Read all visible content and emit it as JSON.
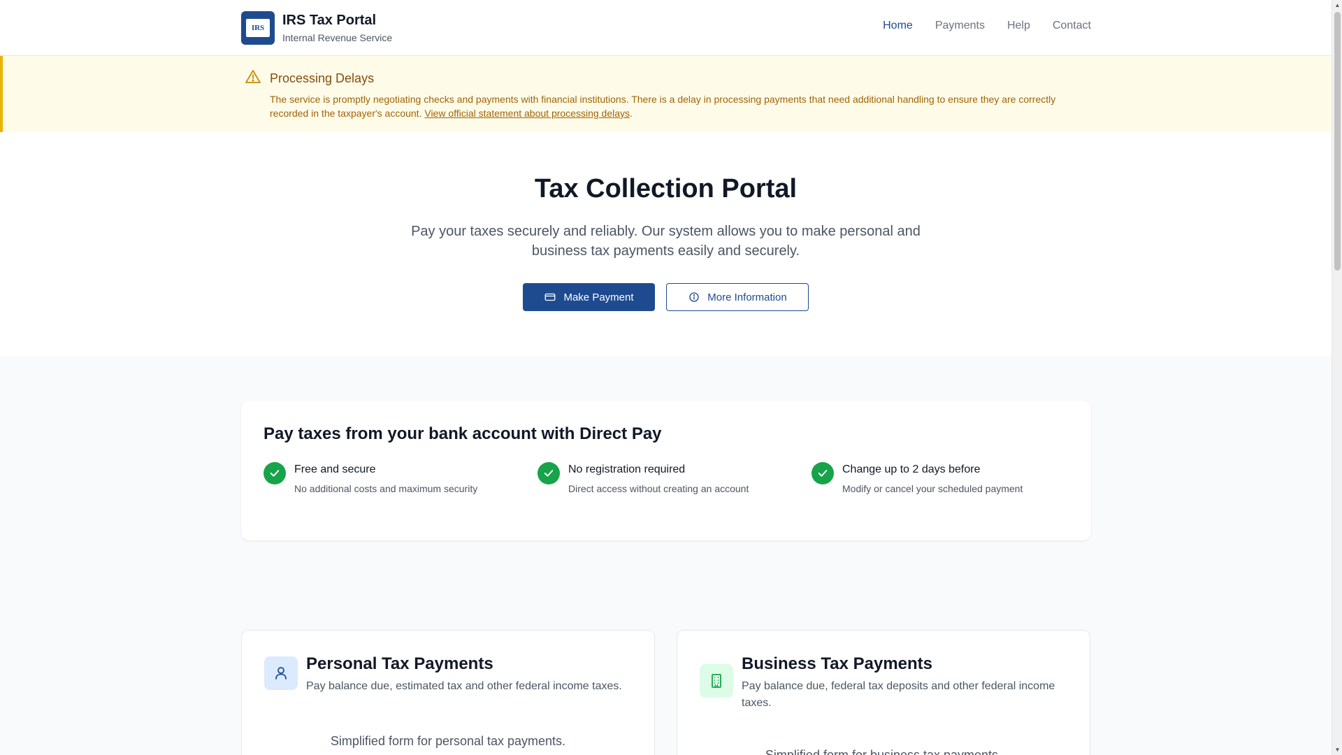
{
  "header": {
    "logo_text": "IRS",
    "title": "IRS Tax Portal",
    "subtitle": "Internal Revenue Service",
    "nav": [
      {
        "label": "Home",
        "active": true
      },
      {
        "label": "Payments",
        "active": false
      },
      {
        "label": "Help",
        "active": false
      },
      {
        "label": "Contact",
        "active": false
      }
    ]
  },
  "alert": {
    "icon": "warning-icon",
    "title": "Processing Delays",
    "body": "The service is promptly negotiating checks and payments with financial institutions. There is a delay in processing payments that need additional handling to ensure they are correctly recorded in the taxpayer's account.",
    "link_text": "View official statement about processing delays",
    "link_suffix": "."
  },
  "hero": {
    "title": "Tax Collection Portal",
    "subtitle": "Pay your taxes securely and reliably. Our system allows you to make personal and business tax payments easily and securely.",
    "primary_button": {
      "label": "Make Payment",
      "icon": "credit-card-icon"
    },
    "secondary_button": {
      "label": "More Information",
      "icon": "info-icon"
    }
  },
  "direct_pay": {
    "title": "Pay taxes from your bank account with Direct Pay",
    "features": [
      {
        "title": "Free and secure",
        "description": "No additional costs and maximum security"
      },
      {
        "title": "No registration required",
        "description": "Direct access without creating an account"
      },
      {
        "title": "Change up to 2 days before",
        "description": "Modify or cancel your scheduled payment"
      }
    ]
  },
  "payment_options": {
    "personal": {
      "icon": "user-icon",
      "title": "Personal Tax Payments",
      "description": "Pay balance due, estimated tax and other federal income taxes.",
      "note": "Simplified form for personal tax payments."
    },
    "business": {
      "icon": "building-icon",
      "title": "Business Tax Payments",
      "description": "Pay balance due, federal tax deposits and other federal income taxes.",
      "note": "Simplified form for business tax payments."
    }
  },
  "colors": {
    "brand": "#1e4b8f",
    "alert_bg": "#fefce8",
    "alert_border": "#eab308",
    "alert_text": "#a16207",
    "success": "#16a34a"
  }
}
